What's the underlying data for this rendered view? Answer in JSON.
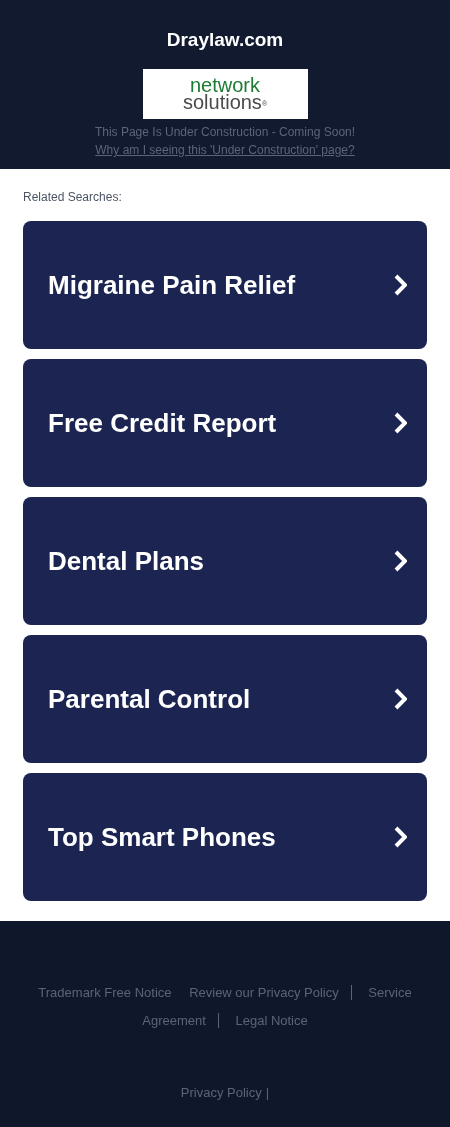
{
  "header": {
    "title": "Draylaw.com",
    "logo": {
      "line_1": "network",
      "line_2": "solutions",
      "mark": "®"
    },
    "notice": "This Page Is Under Construction - Coming Soon!",
    "link": "Why am I seeing this 'Under Construction' page?"
  },
  "related": {
    "heading": "Related Searches:",
    "items": [
      {
        "label": "Migraine Pain Relief"
      },
      {
        "label": "Free Credit Report"
      },
      {
        "label": "Dental Plans"
      },
      {
        "label": "Parental Control"
      },
      {
        "label": "Top Smart Phones"
      }
    ]
  },
  "footer": {
    "links": [
      {
        "label": "Trademark Free Notice",
        "divider": false
      },
      {
        "label": "Review our Privacy Policy",
        "divider": true
      },
      {
        "label": "Service",
        "divider": false
      },
      {
        "label": "Agreement",
        "divider": true
      },
      {
        "label": "Legal Notice",
        "divider": false
      }
    ],
    "bottom_link": "Privacy Policy",
    "bottom_separator": "|"
  }
}
